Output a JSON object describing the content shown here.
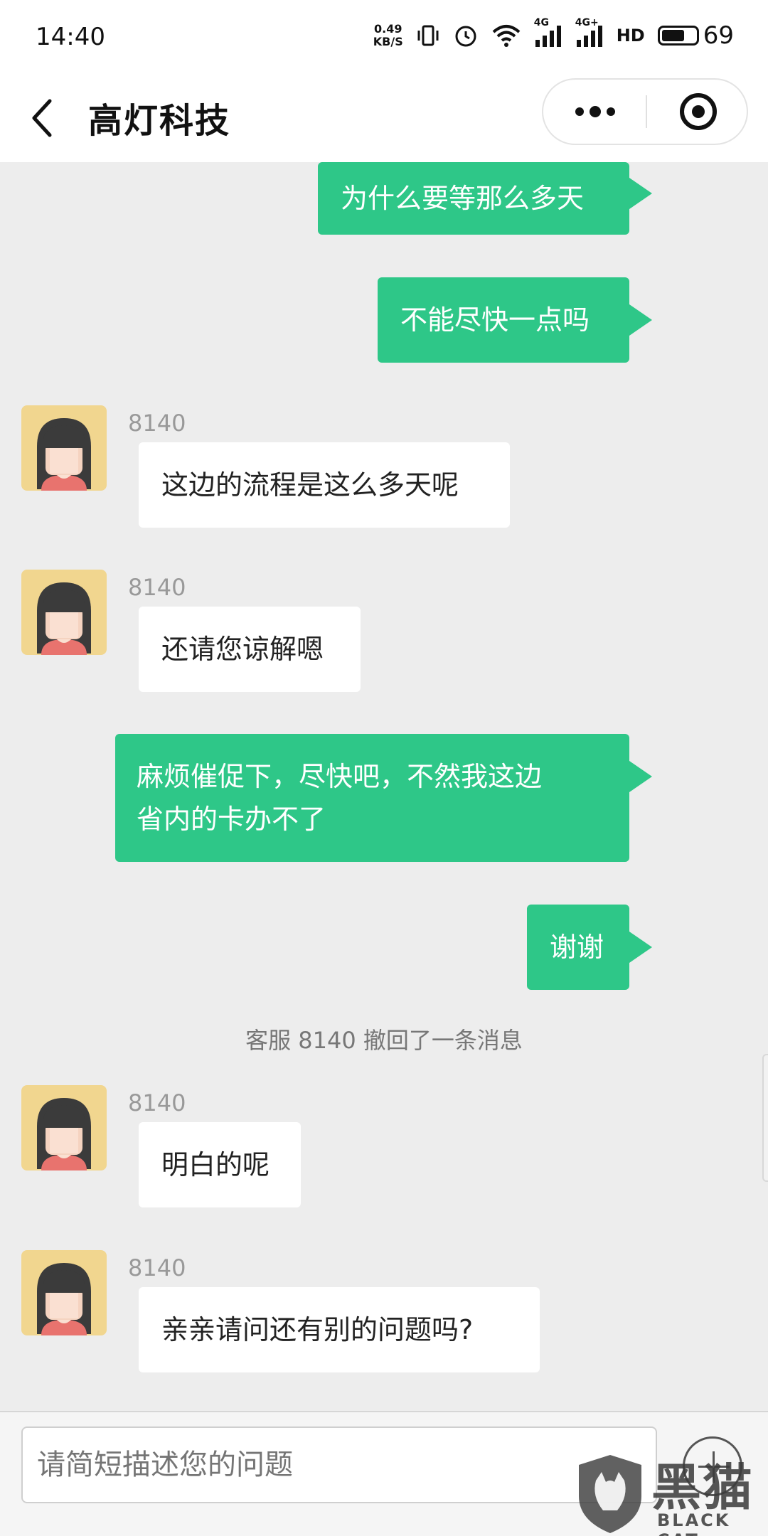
{
  "status_bar": {
    "time": "14:40",
    "net_speed_value": "0.49",
    "net_speed_unit": "KB/S",
    "signal1_label": "4G",
    "signal2_label": "4G+",
    "hd_label": "HD",
    "battery_level": "69",
    "battery_fraction": 0.69
  },
  "nav": {
    "title": "高灯科技",
    "icons": {
      "back": "chevron-left-icon",
      "more": "more-dots-icon",
      "close": "target-close-icon"
    }
  },
  "messages": [
    {
      "direction": "out",
      "text": "为什么要等那么多天"
    },
    {
      "direction": "out",
      "text": "不能尽快一点吗"
    },
    {
      "direction": "in",
      "sender": "8140",
      "text": "这边的流程是这么多天呢"
    },
    {
      "direction": "in",
      "sender": "8140",
      "text": "还请您谅解嗯"
    },
    {
      "direction": "out",
      "text_line1": "麻烦催促下，尽快吧，不然我这边",
      "text_line2": "省内的卡办不了"
    },
    {
      "direction": "out",
      "text": "谢谢"
    },
    {
      "type": "system",
      "text": "客服 8140 撤回了一条消息"
    },
    {
      "direction": "in",
      "sender": "8140",
      "text": "明白的呢"
    },
    {
      "direction": "in",
      "sender": "8140",
      "text": "亲亲请问还有别的问题吗?"
    }
  ],
  "input": {
    "placeholder": "请简短描述您的问题",
    "value": ""
  },
  "watermark": {
    "cn": "黑猫",
    "en": "BLACK CAT"
  },
  "colors": {
    "outgoing_bubble": "#2ec788",
    "incoming_bubble": "#ffffff",
    "chat_background": "#ededed"
  }
}
